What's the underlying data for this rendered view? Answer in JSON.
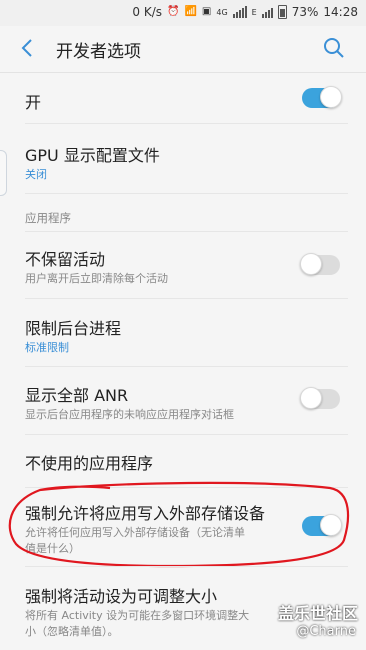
{
  "status_bar": {
    "net_speed": "0 K/s",
    "network": "4G",
    "battery": "73%",
    "time": "14:28"
  },
  "app_bar": {
    "title": "开发者选项"
  },
  "master_toggle": {
    "label": "开",
    "state": "on"
  },
  "items": [
    {
      "title": "GPU 显示配置文件",
      "subtitle": "关闭"
    },
    {
      "section": "应用程序"
    },
    {
      "title": "不保留活动",
      "subtitle": "用户离开后立即清除每个活动",
      "toggle": "off"
    },
    {
      "title": "限制后台进程",
      "subtitle": "标准限制"
    },
    {
      "title": "显示全部 ANR",
      "subtitle": "显示后台应用程序的未响应应用程序对话框",
      "toggle": "off"
    },
    {
      "title": "不使用的应用程序"
    },
    {
      "title": "强制允许将应用写入外部存储设备",
      "subtitle_line1": "允许将任何应用写入外部存储设备（无论清单",
      "subtitle_line2": "值是什么）",
      "toggle": "on"
    },
    {
      "title": "强制将活动设为可调整大小",
      "subtitle_line1": "将所有 Activity 设为可能在多窗口环境调整大",
      "subtitle_line2": "小（忽略清单值）。"
    }
  ],
  "watermark": {
    "line1": "盖乐世社区",
    "line2": "@Charne"
  },
  "colors": {
    "accent": "#3ba3dd",
    "annotation": "#e0171f"
  }
}
